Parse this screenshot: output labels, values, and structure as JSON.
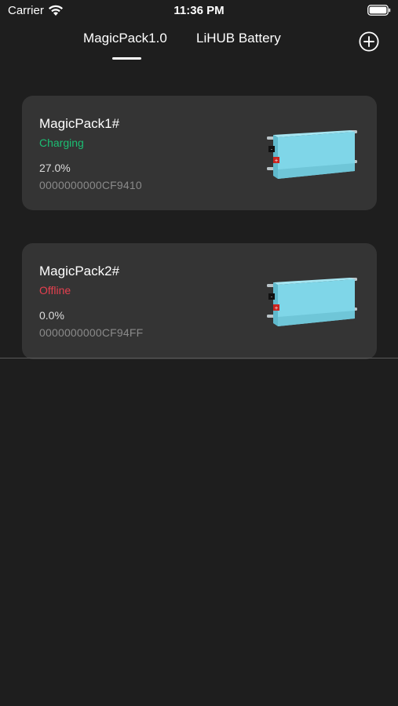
{
  "status_bar": {
    "carrier": "Carrier",
    "time": "11:36 PM"
  },
  "tabs": [
    {
      "label": "MagicPack1.0",
      "selected": true
    },
    {
      "label": "LiHUB Battery",
      "selected": false
    }
  ],
  "add_icon": "plus-circle-icon",
  "devices": [
    {
      "name": "MagicPack1#",
      "status": "Charging",
      "status_color": "#1bbf73",
      "percent": "27.0%",
      "serial": "0000000000CF9410",
      "image_icon": "battery-pack-icon"
    },
    {
      "name": "MagicPack2#",
      "status": "Offline",
      "status_color": "#e5404f",
      "percent": "0.0%",
      "serial": "0000000000CF94FF",
      "image_icon": "battery-pack-icon"
    }
  ],
  "colors": {
    "background": "#1e1e1e",
    "card": "#343434",
    "battery_body": "#7fd6e8"
  }
}
